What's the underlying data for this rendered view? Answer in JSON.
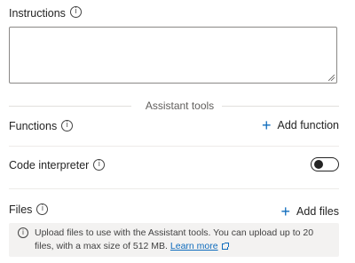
{
  "instructions": {
    "label": "Instructions",
    "value": ""
  },
  "assistant_tools": {
    "section_title": "Assistant tools",
    "functions": {
      "label": "Functions",
      "add_label": "Add function"
    },
    "code_interpreter": {
      "label": "Code interpreter",
      "enabled": false
    },
    "files": {
      "label": "Files",
      "add_label": "Add files",
      "info_text": "Upload files to use with the Assistant tools. You can upload up to 20 files, with a max size of 512 MB.",
      "learn_more": "Learn more"
    }
  },
  "icons": {
    "info": "info-icon",
    "add": "plus-icon",
    "external_link": "external-link-icon"
  },
  "colors": {
    "accent": "#0f6cbd",
    "text": "#242424",
    "info_bar_bg": "#f3f2f1"
  }
}
